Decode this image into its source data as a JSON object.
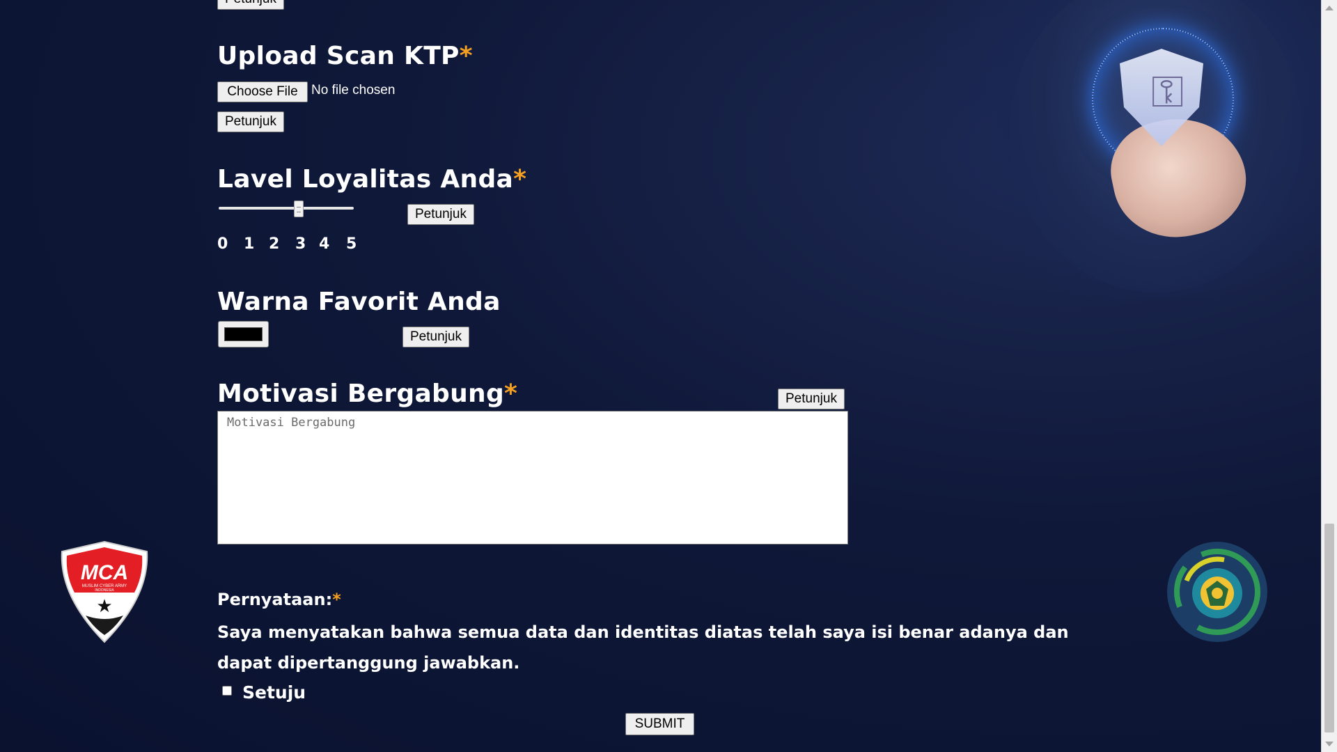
{
  "top_button": {
    "label": "Petunjuk"
  },
  "ktp": {
    "title": "Upload Scan KTP",
    "required_mark": "*",
    "choose_file_label": "Choose File",
    "file_status": "No file chosen",
    "hint_label": "Petunjuk"
  },
  "loyalty": {
    "title": "Lavel Loyalitas Anda",
    "required_mark": "*",
    "hint_label": "Petunjuk",
    "ticks": [
      "0",
      "1",
      "2",
      "3",
      "4",
      "5"
    ],
    "value": 3
  },
  "color": {
    "title": "Warna Favorit Anda",
    "value": "#000000",
    "hint_label": "Petunjuk"
  },
  "motivation": {
    "title": "Motivasi Bergabung",
    "required_mark": "*",
    "hint_label": "Petunjuk",
    "placeholder": "Motivasi Bergabung"
  },
  "statement": {
    "title": "Pernyataan:",
    "required_mark": "*",
    "text": "Saya menyatakan bahwa semua data dan identitas diatas telah saya isi benar adanya dan dapat dipertanggung jawabkan.",
    "agree_label": "Setuju"
  },
  "submit": {
    "label": "SUBMIT"
  },
  "logos": {
    "left_text": "MCA",
    "left_subtext": "MUSLIM CYBER ARMY",
    "left_subtext2": "INDONESIA"
  },
  "colors": {
    "accent_required": "#f5a020",
    "background": "#0f1838",
    "mca_red": "#e31e24"
  },
  "icons": {
    "hero": "shield-key-icon",
    "left_logo": "mca-logo",
    "right_logo": "university-seal-logo"
  }
}
